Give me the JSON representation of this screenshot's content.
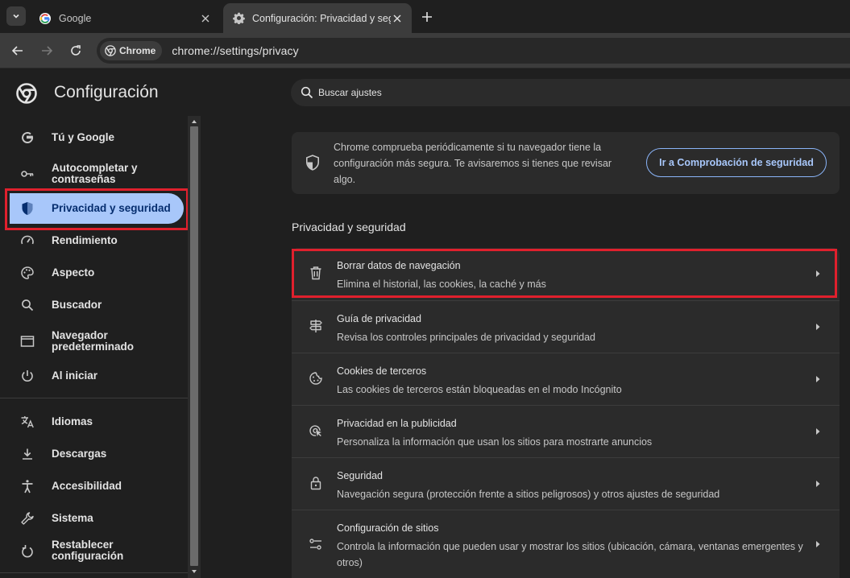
{
  "tabs": [
    {
      "title": "Google",
      "icon": "google-g-icon",
      "active": false
    },
    {
      "title": "Configuración: Privacidad y seguridad",
      "icon": "gear-icon",
      "active": true
    }
  ],
  "toolbar": {
    "chip_label": "Chrome",
    "url": "chrome://settings/privacy"
  },
  "header": {
    "title": "Configuración",
    "search_placeholder": "Buscar ajustes"
  },
  "sidebar": {
    "items": [
      {
        "label": "Tú y Google",
        "icon": "google-g-icon"
      },
      {
        "label": "Autocompletar y contraseñas",
        "icon": "key-icon"
      },
      {
        "label": "Privacidad y seguridad",
        "icon": "shield-icon",
        "active": true
      },
      {
        "label": "Rendimiento",
        "icon": "speedometer-icon"
      },
      {
        "label": "Aspecto",
        "icon": "palette-icon"
      },
      {
        "label": "Buscador",
        "icon": "search-icon"
      },
      {
        "label": "Navegador predeterminado",
        "icon": "browser-window-icon"
      },
      {
        "label": "Al iniciar",
        "icon": "power-icon"
      },
      {
        "label": "Idiomas",
        "icon": "translate-icon"
      },
      {
        "label": "Descargas",
        "icon": "download-icon"
      },
      {
        "label": "Accesibilidad",
        "icon": "accessibility-icon"
      },
      {
        "label": "Sistema",
        "icon": "wrench-icon"
      },
      {
        "label": "Restablecer configuración",
        "icon": "reset-icon"
      }
    ]
  },
  "safety_check": {
    "text": "Chrome comprueba periódicamente si tu navegador tiene la configuración más segura. Te avisaremos si tienes que revisar algo.",
    "button": "Ir a Comprobación de seguridad"
  },
  "privacy": {
    "section_title": "Privacidad y seguridad",
    "rows": [
      {
        "title": "Borrar datos de navegación",
        "subtitle": "Elimina el historial, las cookies, la caché y más",
        "icon": "trash-icon"
      },
      {
        "title": "Guía de privacidad",
        "subtitle": "Revisa los controles principales de privacidad y seguridad",
        "icon": "signpost-icon"
      },
      {
        "title": "Cookies de terceros",
        "subtitle": "Las cookies de terceros están bloqueadas en el modo Incógnito",
        "icon": "cookie-icon"
      },
      {
        "title": "Privacidad en la publicidad",
        "subtitle": "Personaliza la información que usan los sitios para mostrarte anuncios",
        "icon": "ad-privacy-icon"
      },
      {
        "title": "Seguridad",
        "subtitle": "Navegación segura (protección frente a sitios peligrosos) y otros ajustes de seguridad",
        "icon": "lock-icon"
      },
      {
        "title": "Configuración de sitios",
        "subtitle": "Controla la información que pueden usar y mostrar los sitios (ubicación, cámara, ventanas emergentes y otros)",
        "icon": "sliders-icon"
      }
    ]
  },
  "colors": {
    "background": "#1f1f1f",
    "active_nav": "#a8c7fa",
    "highlight": "#e0202d",
    "link": "#a8c7fa"
  }
}
